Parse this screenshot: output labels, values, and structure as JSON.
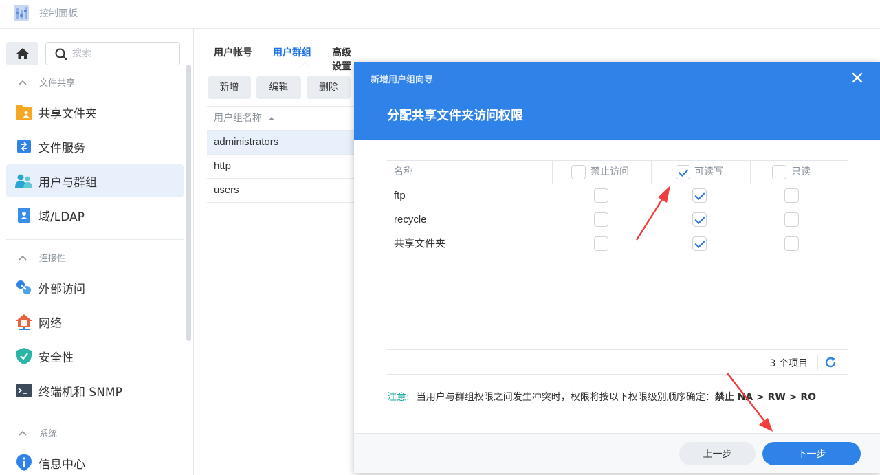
{
  "window": {
    "title": "控制面板"
  },
  "sidebar": {
    "search_placeholder": "搜索",
    "sections": [
      {
        "title": "文件共享",
        "items": [
          "共享文件夹",
          "文件服务",
          "用户与群组",
          "域/LDAP"
        ]
      },
      {
        "title": "连接性",
        "items": [
          "外部访问",
          "网络",
          "安全性",
          "终端机和 SNMP"
        ]
      },
      {
        "title": "系统",
        "items": [
          "信息中心"
        ]
      }
    ],
    "active_item": "用户与群组"
  },
  "main": {
    "tabs": [
      "用户帐号",
      "用户群组",
      "高级设置"
    ],
    "active_tab": "用户群组",
    "toolbar": {
      "add": "新增",
      "edit": "编辑",
      "delete": "删除"
    },
    "groups_table": {
      "column": "用户组名称",
      "rows": [
        "administrators",
        "http",
        "users"
      ],
      "selected": "administrators"
    }
  },
  "dialog": {
    "title": "新增用户组向导",
    "step_title": "分配共享文件夹访问权限",
    "columns": {
      "name": "名称",
      "deny": "禁止访问",
      "rw": "可读写",
      "ro": "只读"
    },
    "header_checks": {
      "deny": false,
      "rw": true,
      "ro": false
    },
    "rows": [
      {
        "name": "ftp",
        "deny": false,
        "rw": true,
        "ro": false
      },
      {
        "name": "recycle",
        "deny": false,
        "rw": true,
        "ro": false
      },
      {
        "name": "共享文件夹",
        "deny": false,
        "rw": true,
        "ro": false
      }
    ],
    "item_count": "3 个项目",
    "note_label": "注意:",
    "note_text": "当用户与群组权限之间发生冲突时，权限将按以下权限级别顺序确定：",
    "note_order": "禁止 NA > RW > RO",
    "buttons": {
      "prev": "上一步",
      "next": "下一步"
    }
  },
  "colors": {
    "accent": "#2f82e7",
    "note_label": "#1aa79a",
    "annotation_arrow": "#f23d3d"
  }
}
